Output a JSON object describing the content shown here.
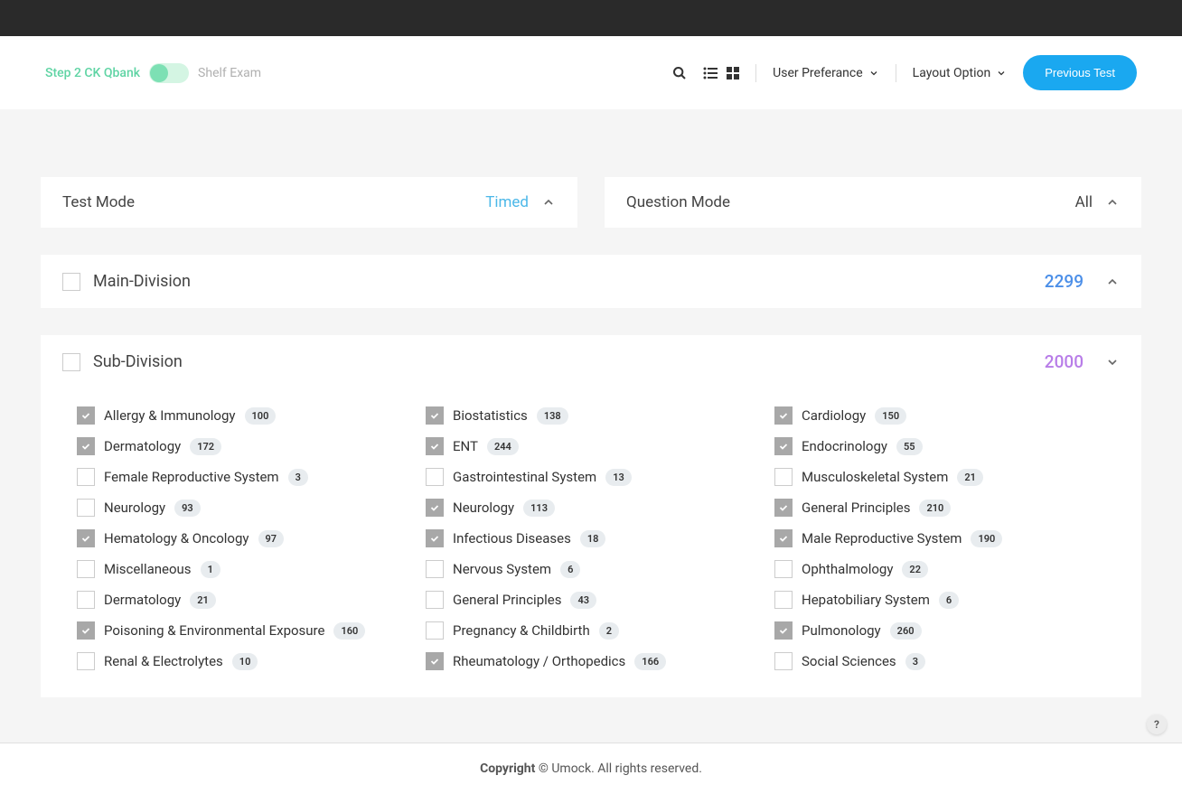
{
  "header": {
    "qbank_label": "Step 2 CK Qbank",
    "shelf_label": "Shelf Exam",
    "user_pref_label": "User Preferance",
    "layout_label": "Layout Option",
    "prev_test_label": "Previous Test"
  },
  "test_mode": {
    "title": "Test Mode",
    "value": "Timed"
  },
  "question_mode": {
    "title": "Question Mode",
    "value": "All"
  },
  "main_division": {
    "title": "Main-Division",
    "count": "2299"
  },
  "sub_division": {
    "title": "Sub-Division",
    "count": "2000",
    "items": [
      {
        "label": "Allergy & Immunology",
        "count": "100",
        "checked": true
      },
      {
        "label": "Biostatistics",
        "count": "138",
        "checked": true
      },
      {
        "label": "Cardiology",
        "count": "150",
        "checked": true
      },
      {
        "label": "Dermatology",
        "count": "172",
        "checked": true
      },
      {
        "label": "ENT",
        "count": "244",
        "checked": true
      },
      {
        "label": "Endocrinology",
        "count": "55",
        "checked": true
      },
      {
        "label": "Female Reproductive System",
        "count": "3",
        "checked": false
      },
      {
        "label": "Gastrointestinal System",
        "count": "13",
        "checked": false
      },
      {
        "label": "Musculoskeletal System",
        "count": "21",
        "checked": false
      },
      {
        "label": "Neurology",
        "count": "93",
        "checked": false
      },
      {
        "label": "Neurology",
        "count": "113",
        "checked": true
      },
      {
        "label": "General Principles",
        "count": "210",
        "checked": true
      },
      {
        "label": "Hematology & Oncology",
        "count": "97",
        "checked": true
      },
      {
        "label": "Infectious Diseases",
        "count": "18",
        "checked": true
      },
      {
        "label": "Male Reproductive System",
        "count": "190",
        "checked": true
      },
      {
        "label": "Miscellaneous",
        "count": "1",
        "checked": false
      },
      {
        "label": "Nervous System",
        "count": "6",
        "checked": false
      },
      {
        "label": "Ophthalmology",
        "count": "22",
        "checked": false
      },
      {
        "label": "Dermatology",
        "count": "21",
        "checked": false
      },
      {
        "label": "General Principles",
        "count": "43",
        "checked": false
      },
      {
        "label": "Hepatobiliary System",
        "count": "6",
        "checked": false
      },
      {
        "label": "Poisoning & Environmental Exposure",
        "count": "160",
        "checked": true
      },
      {
        "label": "Pregnancy & Childbirth",
        "count": "2",
        "checked": false
      },
      {
        "label": "Pulmonology",
        "count": "260",
        "checked": true
      },
      {
        "label": "Renal & Electrolytes",
        "count": "10",
        "checked": false
      },
      {
        "label": "Rheumatology / Orthopedics",
        "count": "166",
        "checked": true
      },
      {
        "label": "Social Sciences",
        "count": "3",
        "checked": false
      }
    ]
  },
  "footer": {
    "bold": "Copyright",
    "rest": " © Umock. All rights reserved."
  },
  "help": "?"
}
